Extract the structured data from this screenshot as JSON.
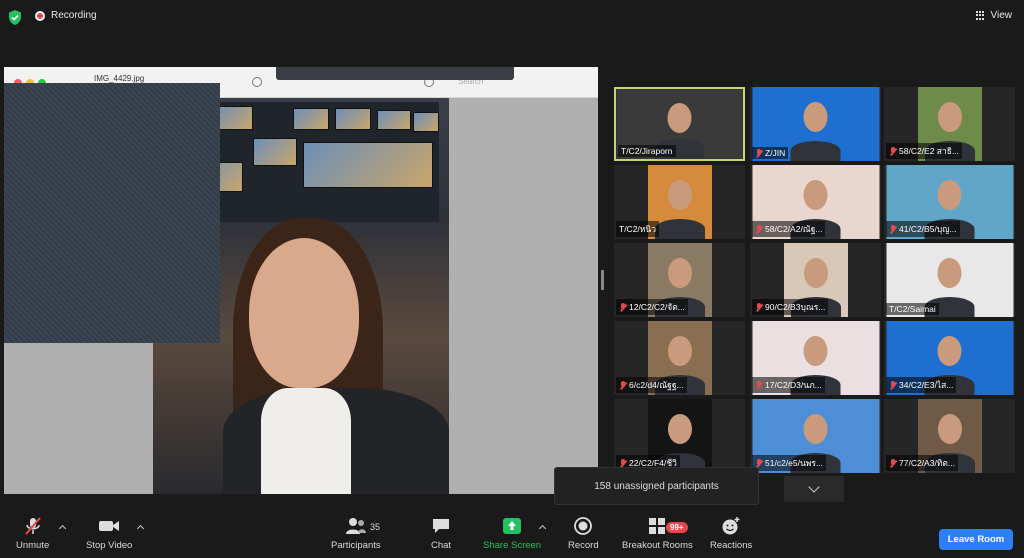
{
  "top_bar": {
    "recording_label": "Recording",
    "view_label": "View"
  },
  "shared_screen": {
    "file_name": "IMG_4429.jpg",
    "search_placeholder": "Search"
  },
  "gallery": {
    "tiles": [
      {
        "name": "T/C2/Jiraporn",
        "muted": false,
        "active": true,
        "bg": "#3a3a3a"
      },
      {
        "name": "Z/JIN",
        "muted": true,
        "active": false,
        "bg": "#1f6fd1"
      },
      {
        "name": "58/C2/E2 สาธิ...",
        "muted": true,
        "active": false,
        "bg": "#6f8b4a"
      },
      {
        "name": "T/C2/หนิว",
        "muted": false,
        "active": false,
        "bg": "#d68a3c"
      },
      {
        "name": "58/C2/A2/ณัฐ...",
        "muted": true,
        "active": false,
        "bg": "#e9d7cf"
      },
      {
        "name": "41/C2/B5/บุญ...",
        "muted": true,
        "active": false,
        "bg": "#5fa6c9"
      },
      {
        "name": "12/C2/C2/จัต...",
        "muted": true,
        "active": false,
        "bg": "#8a7a63"
      },
      {
        "name": "90/C2/B3บุณร...",
        "muted": true,
        "active": false,
        "bg": "#d9c7b8"
      },
      {
        "name": "T/C2/Saimai",
        "muted": false,
        "active": false,
        "bg": "#e8e8e8"
      },
      {
        "name": "6/c2/d4/ณัฐฐ...",
        "muted": true,
        "active": false,
        "bg": "#8a6e52"
      },
      {
        "name": "17/C2/D3/นภ...",
        "muted": true,
        "active": false,
        "bg": "#eadfe1"
      },
      {
        "name": "34/C2/E3/ไส...",
        "muted": true,
        "active": false,
        "bg": "#1f6fd1"
      },
      {
        "name": "22/C2/F4/ชีวิ",
        "muted": true,
        "active": false,
        "bg": "#141414"
      },
      {
        "name": "51/c2/e5/นพร...",
        "muted": true,
        "active": false,
        "bg": "#4d8ed6"
      },
      {
        "name": "77/C2/A3/ทิต...",
        "muted": true,
        "active": false,
        "bg": "#6e5a46"
      }
    ]
  },
  "tooltip": {
    "text": "158 unassigned participants"
  },
  "toolbar": {
    "unmute_label": "Unmute",
    "stop_video_label": "Stop Video",
    "participants_label": "Participants",
    "participants_count": "35",
    "chat_label": "Chat",
    "share_screen_label": "Share Screen",
    "record_label": "Record",
    "breakout_rooms_label": "Breakout Rooms",
    "breakout_badge": "99+",
    "reactions_label": "Reactions",
    "leave_label": "Leave Room"
  },
  "colors": {
    "accent_blue": "#2d7ff9",
    "share_green": "#23c160",
    "alert_red": "#e34b4b",
    "active_speaker": "#c5d46b"
  }
}
